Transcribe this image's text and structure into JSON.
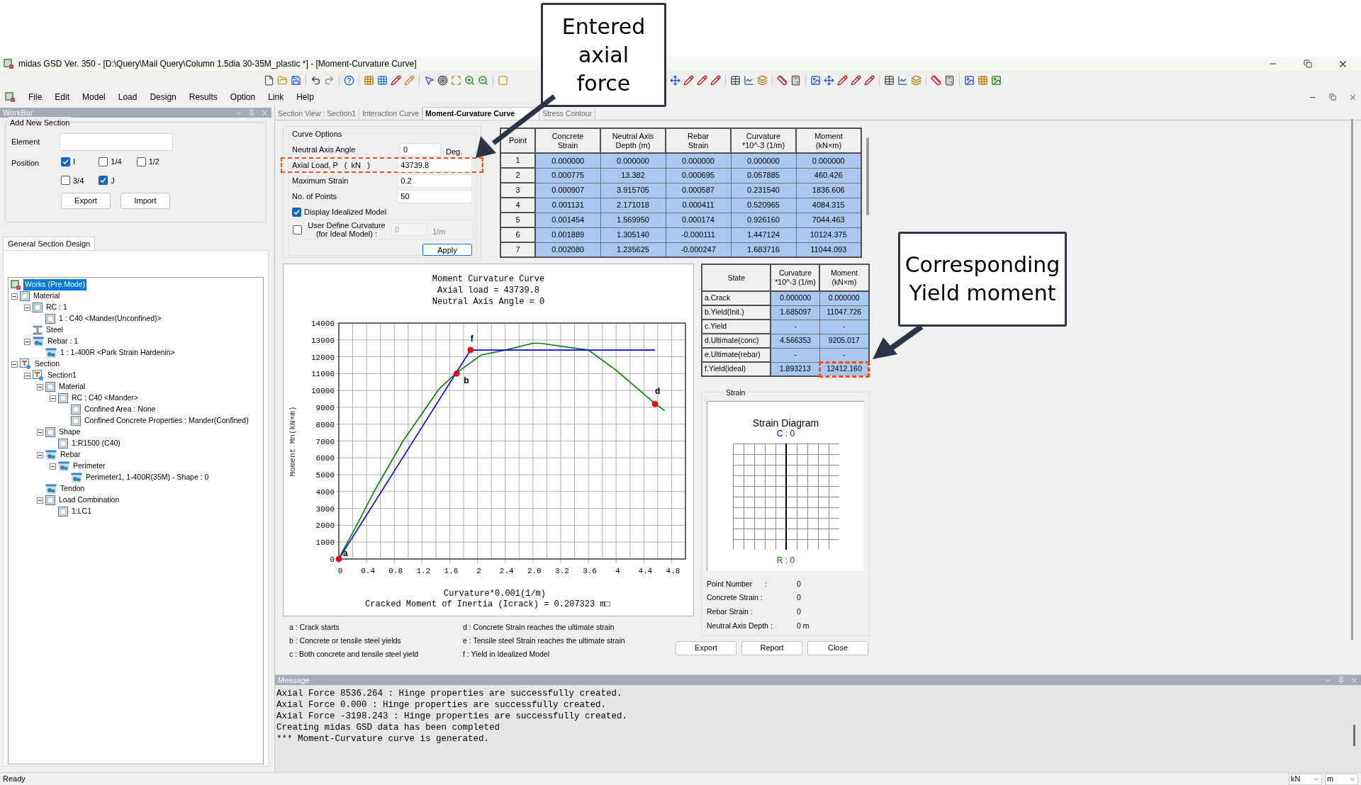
{
  "window": {
    "title": "midas GSD Ver. 350 - [D:\\Query\\Mail Query\\Column 1.5dia 30-35M_plastic *] - [Moment-Curvature Curve]"
  },
  "menu": [
    "File",
    "Edit",
    "Model",
    "Load",
    "Design",
    "Results",
    "Option",
    "Link",
    "Help"
  ],
  "workbar": {
    "title": "WorkBar",
    "add_section": {
      "title": "Add New Section",
      "element_label": "Element",
      "position_label": "Position",
      "positions": [
        {
          "label": "I",
          "checked": true
        },
        {
          "label": "1/4",
          "checked": false
        },
        {
          "label": "1/2",
          "checked": false
        },
        {
          "label": "3/4",
          "checked": false
        },
        {
          "label": "J",
          "checked": true
        }
      ],
      "buttons": [
        "Export",
        "Import"
      ]
    },
    "tab": "General Section Design",
    "tree": [
      {
        "label": "Works (Pre.Mode)",
        "kind": "works",
        "selected": true,
        "children": [
          {
            "label": "Material",
            "kind": "box",
            "selected": false,
            "expanded": true,
            "children": [
              {
                "label": "RC : 1",
                "kind": "box",
                "selected": false,
                "expanded": true,
                "children": [
                  {
                    "label": "1 : C40 <Mander(Unconfined)>",
                    "kind": "box",
                    "selected": false
                  }
                ]
              },
              {
                "label": "Steel",
                "kind": "beam",
                "selected": false
              },
              {
                "label": "Rebar : 1",
                "kind": "rebar",
                "selected": false,
                "expanded": true,
                "children": [
                  {
                    "label": "1 : 1-400R <Park Strain Hardenin>",
                    "kind": "rebar",
                    "selected": false
                  }
                ]
              }
            ]
          },
          {
            "label": "Section",
            "kind": "section",
            "selected": false,
            "expanded": true,
            "children": [
              {
                "label": "Section1",
                "kind": "section",
                "selected": false,
                "expanded": true,
                "children": [
                  {
                    "label": "Material",
                    "kind": "box",
                    "selected": false,
                    "expanded": true,
                    "children": [
                      {
                        "label": "RC : C40 <Mander>",
                        "kind": "box",
                        "selected": false,
                        "expanded": true,
                        "children": [
                          {
                            "label": "Confined Area : None",
                            "kind": "box",
                            "selected": false
                          },
                          {
                            "label": "Confined Concrete Properties : Mander(Confined)",
                            "kind": "box",
                            "selected": false
                          }
                        ]
                      }
                    ]
                  },
                  {
                    "label": "Shape",
                    "kind": "box",
                    "selected": false,
                    "expanded": true,
                    "children": [
                      {
                        "label": "1:R1500 (C40)",
                        "kind": "box",
                        "selected": false
                      }
                    ]
                  },
                  {
                    "label": "Rebar",
                    "kind": "rebar",
                    "selected": false,
                    "expanded": true,
                    "children": [
                      {
                        "label": "Perimeter",
                        "kind": "rebar",
                        "selected": false,
                        "expanded": true,
                        "children": [
                          {
                            "label": "Perimeter1, 1-400R(35M) - Shape : 0",
                            "kind": "rebar",
                            "selected": false
                          }
                        ]
                      }
                    ]
                  },
                  {
                    "label": "Tendon",
                    "kind": "rebar",
                    "selected": false
                  },
                  {
                    "label": "Load Combination",
                    "kind": "box",
                    "selected": false,
                    "expanded": true,
                    "children": [
                      {
                        "label": "1:LC1",
                        "kind": "box",
                        "selected": false
                      }
                    ]
                  }
                ]
              }
            ]
          }
        ]
      }
    ]
  },
  "document_tabs": [
    {
      "label": "Section View : Section1",
      "selected": false
    },
    {
      "label": "Interaction Curve",
      "selected": false
    },
    {
      "label": "Moment-Curvature Curve",
      "selected": true
    },
    {
      "label": "Stress Contour",
      "selected": false
    }
  ],
  "curve_options": {
    "title": "Curve Options",
    "fields": [
      {
        "label": "Neutral Axis Angle",
        "value": "0",
        "unit": "Deg.",
        "highlighted": false
      },
      {
        "label": "Axial Load, P   (  kN   )",
        "value": "43739.8",
        "highlighted": true
      },
      {
        "label": "Maximum Strain",
        "value": "0.2",
        "highlighted": false
      },
      {
        "label": "No. of Points",
        "value": "50",
        "highlighted": false
      }
    ],
    "display_idealized": {
      "label": "Display Idealized Model",
      "checked": true
    },
    "user_define": {
      "label": "User Define Curvature\n(for Ideal  Model) :",
      "checked": false,
      "disabled": true,
      "value": "0",
      "unit": "1/m"
    },
    "apply": "Apply"
  },
  "points_table": {
    "columns": [
      "Point",
      "Concrete\nStrain",
      "Neutral Axis\nDepth (m)",
      "Rebar\nStrain",
      "Curvature\n*10^-3 (1/m)",
      "Moment\n(kN×m)"
    ],
    "rows": [
      [
        "1",
        "0.000000",
        "0.000000",
        "0.000000",
        "0.000000",
        "0.000000"
      ],
      [
        "2",
        "0.000775",
        "13.382",
        "0.000695",
        "0.057885",
        "460.426"
      ],
      [
        "3",
        "0.000907",
        "3.915705",
        "0.000587",
        "0.231540",
        "1836.606"
      ],
      [
        "4",
        "0.001131",
        "2.171018",
        "0.000411",
        "0.520965",
        "4084.315"
      ],
      [
        "5",
        "0.001454",
        "1.569950",
        "0.000174",
        "0.926160",
        "7044.463"
      ],
      [
        "6",
        "0.001889",
        "1.305140",
        "-0.000111",
        "1.447124",
        "10124.375"
      ],
      [
        "7",
        "0.002080",
        "1.235625",
        "-0.000247",
        "1.683716",
        "11044.093"
      ]
    ]
  },
  "chart": {
    "subtitles": [
      "Axial load = 43739.8",
      "Neutral Axis Angle = 0"
    ],
    "note": "Cracked Moment of Inertia (Icrack) = 0.207323 m□",
    "chart_data": {
      "type": "line",
      "grid": true,
      "title": "Moment Curvature Curve",
      "xlabel": "Curvature*0.001(1/m)",
      "ylabel": "Moment Mn(kN×m)",
      "xlim": [
        0,
        5
      ],
      "ylim": [
        0,
        14000
      ],
      "xticks": [
        0,
        0.4,
        0.8,
        1.2,
        1.6,
        2,
        2.4,
        2.8,
        3.2,
        3.6,
        4,
        4.4,
        4.8
      ],
      "yticks": [
        0,
        1000,
        2000,
        3000,
        4000,
        5000,
        6000,
        7000,
        8000,
        9000,
        10000,
        11000,
        12000,
        13000,
        14000
      ],
      "series": [
        {
          "color": "#008000",
          "x": [
            0,
            0.058,
            0.232,
            0.521,
            0.926,
            1.447,
            1.684,
            2.05,
            2.4,
            2.8,
            2.9,
            3.6,
            4.0,
            4.566,
            4.7
          ],
          "values": [
            0,
            500,
            1800,
            4100,
            7000,
            10100,
            11000,
            12100,
            12400,
            12800,
            12800,
            12400,
            11200,
            9200,
            8800
          ]
        },
        {
          "color": "#0000ff",
          "x": [
            0,
            1.9,
            4.56
          ],
          "values": [
            0,
            12400,
            12400
          ]
        }
      ],
      "annotations": [
        {
          "text": "a",
          "x": 0,
          "y": 0
        },
        {
          "text": "b",
          "x": 1.7,
          "y": 11000
        },
        {
          "text": "f",
          "x": 1.9,
          "y": 12400
        },
        {
          "text": "d",
          "x": 4.56,
          "y": 9200
        }
      ]
    }
  },
  "legend": [
    "a : Crack starts",
    "b : Concrete or tensile steel yields",
    "c : Both concrete and tensile steel yield",
    "d : Concrete Strain reaches the ultimate strain",
    "e : Tensile steel Strain reaches the ultimate strain",
    "f : Yield in Idealized Model"
  ],
  "state_table": {
    "columns": [
      "State",
      "Curvature\n*10^-3 (1/m)",
      "Moment\n(kN×m)"
    ],
    "rows": [
      {
        "state": "a.Crack",
        "curvature": "0.000000",
        "moment": "0.000000",
        "highlighted": false
      },
      {
        "state": "b.Yield(Init.)",
        "curvature": "1.685097",
        "moment": "11047.726",
        "highlighted": false
      },
      {
        "state": "c.Yield",
        "curvature": "-",
        "moment": "-",
        "highlighted": false
      },
      {
        "state": "d.Ultimate(conc)",
        "curvature": "4.566353",
        "moment": "9205.017",
        "highlighted": false
      },
      {
        "state": "e.Ultimate(rebar)",
        "curvature": "-",
        "moment": "-",
        "highlighted": false
      },
      {
        "state": "f.Yield(ideal)",
        "curvature": "1.893213",
        "moment": "12412.160",
        "highlighted": true
      }
    ]
  },
  "strain": {
    "title": "Strain",
    "diagram_title": "Strain Diagram",
    "top_label": "C : 0",
    "bottom_label": "R : 0",
    "info": [
      {
        "label": "Point Number      :",
        "value": "0"
      },
      {
        "label": "Concrete Strain :",
        "value": "0"
      },
      {
        "label": "Rebar Strain :",
        "value": "0"
      },
      {
        "label": "Neutral Axis Depth :",
        "value": "0 m"
      }
    ]
  },
  "buttons": [
    "Export",
    "Report",
    "Close"
  ],
  "message": {
    "title": "Message",
    "lines": [
      "Axial Force 8536.264 : Hinge properties are successfully created.",
      "Axial Force 0.000 : Hinge properties are successfully created.",
      "Axial Force -3198.243 : Hinge properties are successfully created.",
      "Creating midas GSD data has been completed",
      "*** Moment-Curvature curve is generated."
    ]
  },
  "status_bar": {
    "text": "Ready",
    "units": [
      "kN",
      "m"
    ]
  },
  "callouts": [
    {
      "text": "Entered\naxial\nforce"
    },
    {
      "text": "Corresponding\nYield moment"
    }
  ]
}
